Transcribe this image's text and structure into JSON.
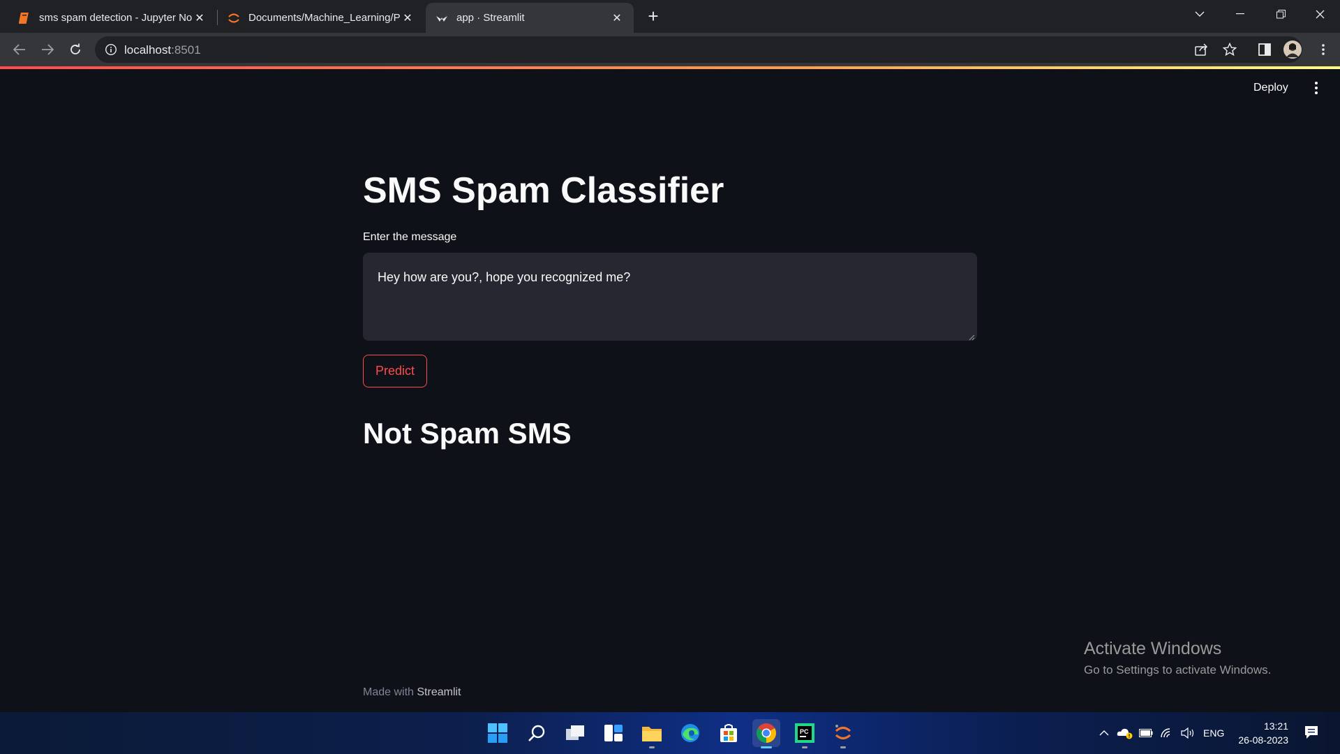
{
  "browser": {
    "tabs": [
      {
        "title": "sms spam detection - Jupyter No",
        "icon": "jupyter-notebook-icon",
        "active": false
      },
      {
        "title": "Documents/Machine_Learning/Pr",
        "icon": "jupyter-icon",
        "active": false
      },
      {
        "title": "app · Streamlit",
        "icon": "streamlit-icon",
        "active": true
      }
    ],
    "url_host": "localhost",
    "url_port": ":8501"
  },
  "app": {
    "deploy_label": "Deploy",
    "title": "SMS Spam Classifier",
    "input_label": "Enter the message",
    "input_value": "Hey how are you?, hope you recognized me?",
    "predict_label": "Predict",
    "result": "Not Spam SMS",
    "footer_prefix": "Made with ",
    "footer_brand": "Streamlit",
    "accent_color": "#ff4b4b"
  },
  "watermark": {
    "line1": "Activate Windows",
    "line2": "Go to Settings to activate Windows."
  },
  "taskbar": {
    "language": "ENG",
    "time": "13:21",
    "date": "26-08-2023"
  }
}
